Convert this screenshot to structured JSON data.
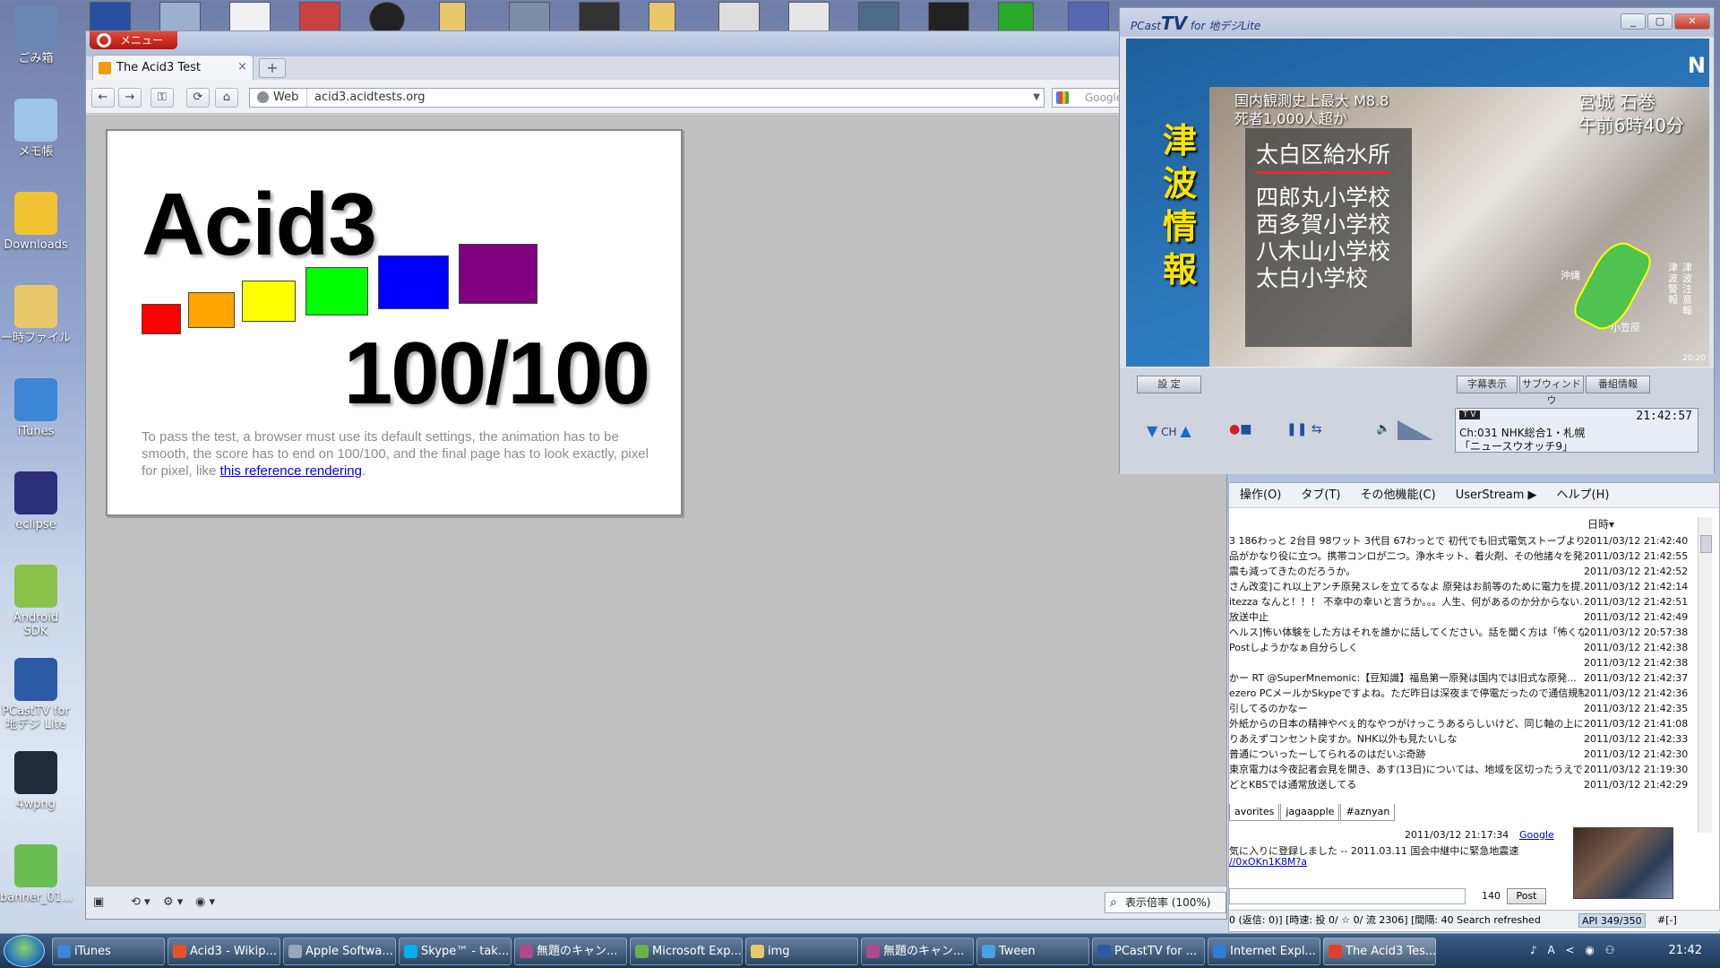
{
  "desktop": {
    "icons": [
      {
        "label": "ごみ箱",
        "color": "#6a87b4"
      },
      {
        "label": "メモ帳",
        "color": "#9ec4e6"
      },
      {
        "label": "Downloads",
        "color": "#f1c232"
      },
      {
        "label": "一時ファイル",
        "color": "#e8c86a"
      },
      {
        "label": "iTunes",
        "color": "#3e86d6"
      },
      {
        "label": "eclipse",
        "color": "#2d2f7a"
      },
      {
        "label": "Android SDK",
        "color": "#8ac249"
      },
      {
        "label": "PCastTV for 地デジ Lite",
        "color": "#2b5aa6"
      },
      {
        "label": "4wpng",
        "color": "#1f2a3a"
      },
      {
        "label": "banner_01...",
        "color": "#6bbf52"
      }
    ]
  },
  "browser": {
    "menu_label": "メニュー",
    "tab_title": "The Acid3 Test",
    "tab_close": "×",
    "newtab": "+",
    "nav": {
      "back": "←",
      "forward": "→",
      "key": "⚿",
      "reload": "⟳",
      "home": "⌂"
    },
    "address": {
      "engine": "Web",
      "url": "acid3.acidtests.org"
    },
    "search_placeholder": "Google",
    "page": {
      "title": "Acid3",
      "score": "100/100",
      "description_before": "To pass the test, a browser must use its default settings, the animation has to be smooth, the score has to end on 100/100, and the final page has to look exactly, pixel for pixel, like ",
      "link_text": "this reference rendering",
      "description_after": ".",
      "squares": [
        {
          "color": "#ff0000"
        },
        {
          "color": "#ffa500"
        },
        {
          "color": "#ffff00"
        },
        {
          "color": "#00ff00"
        },
        {
          "color": "#0000ff"
        },
        {
          "color": "#800080"
        }
      ]
    },
    "zoom": "表示倍率 (100%)"
  },
  "tween": {
    "menu": [
      "操作(O)",
      "タブ(T)",
      "その他機能(C)",
      "UserStream ▶",
      "ヘルプ(H)"
    ],
    "col_date": "日時▾",
    "rows": [
      {
        "text": "3 186わっと 2台目 98ワット 3代目 67わっとで 初代でも旧式電気ストーブより少な...",
        "date": "2011/03/12 21:42:40"
      },
      {
        "text": "品がかなり役に立つ。携帯コンロが二つ。浄水キット、着火剤、その他諸々を発掘し...",
        "date": "2011/03/12 21:42:55"
      },
      {
        "text": "震も減ってきたのだろうか。",
        "date": "2011/03/12 21:42:52"
      },
      {
        "text": "さん改変]これ以上アンチ原発スレを立てるなよ 原発はお前等のために電力を提...",
        "date": "2011/03/12 21:42:14"
      },
      {
        "text": "itezza なんと！！！ 不幸中の幸いと言うか。。。人生、何があるのか分からない...",
        "date": "2011/03/12 21:42:51"
      },
      {
        "text": "放送中止",
        "date": "2011/03/12 21:42:49"
      },
      {
        "text": "ヘルス]怖い体験をした方はそれを誰かに話してください。話を聞く方は「怖くないよ」...",
        "date": "2011/03/12 20:57:38"
      },
      {
        "text": "Postしようかなぁ自分らしく",
        "date": "2011/03/12 21:42:38"
      },
      {
        "text": "",
        "date": "2011/03/12 21:42:38"
      },
      {
        "text": "かー RT @SuperMnemonic:【豆知識】福島第一原発は国内では旧式な原発...",
        "date": "2011/03/12 21:42:37"
      },
      {
        "text": "ezero PCメールかSkypeですよね。ただ昨日は深夜まで停電だったので通信規制...",
        "date": "2011/03/12 21:42:36"
      },
      {
        "text": "引してるのかなー",
        "date": "2011/03/12 21:42:35"
      },
      {
        "text": "外紙からの日本の精神やべぇ的なやつがけっこうあるらしいけど、同じ軸の上にKAR...",
        "date": "2011/03/12 21:41:08"
      },
      {
        "text": "りあえずコンセント戻すか。NHK以外も見たいしな",
        "date": "2011/03/12 21:42:33"
      },
      {
        "text": "普通についったーしてられるのはだいぶ奇跡",
        "date": "2011/03/12 21:42:30"
      },
      {
        "text": "東京電力は今夜記者会見を開き、あす(13日)については、地域を区切ったうえで...",
        "date": "2011/03/12 21:19:30"
      },
      {
        "text": "どとKBSでは通常放送してる",
        "date": "2011/03/12 21:42:29"
      }
    ],
    "tabs": [
      "avorites",
      "jagaapple",
      "#aznyan"
    ],
    "detail": {
      "datetime": "2011/03/12 21:17:34",
      "source": "Google",
      "message": "気に入りに登録しました -- 2011.03.11 国会中継中に緊急地震速",
      "link": "//0xOKn1K8M?a"
    },
    "count": "140",
    "post": "Post",
    "status": "0 (返信: 0)] [時速: 投 0/ ☆ 0/ 流 2306] [間隔: 40",
    "status_search": "Search refreshed",
    "api": "API 349/350",
    "extra": "#[-]"
  },
  "pcast": {
    "logo_small": "PCast",
    "logo_big": "TV",
    "logo_sub": "for 地デジLite",
    "winbtns": [
      "_",
      "▢",
      "✕"
    ],
    "tsunami": "津波情報",
    "tv_n": "N",
    "headline": [
      "国内観測史上最大 M8.8",
      "死者1,000人超か"
    ],
    "location": [
      "宮城 石巻",
      "午前6時40分"
    ],
    "shelter_first": "太白区給水所",
    "shelters": [
      "四郎丸小学校",
      "西多賀小学校",
      "八木山小学校",
      "太白小学校"
    ],
    "map_okinawa": "沖縄",
    "map_ogasawara": "小笠原",
    "legend_warning": "津波警報",
    "legend_advisory": "津波注意報",
    "badge": "20:20",
    "btn_settings": "設 定",
    "btn_subtitle": "字幕表示",
    "btn_subwindow": "サブウィンドウ",
    "btn_program": "番組情報",
    "ch_label": "CH",
    "lcd_tv": "T V",
    "lcd_time": "21:42:57",
    "lcd_channel": "Ch:031  NHK総合1・札幌",
    "lcd_program": "「ニュースウオッチ9」"
  },
  "taskbar": {
    "items": [
      {
        "label": "iTunes",
        "color": "#3e86d6"
      },
      {
        "label": "Acid3 - Wikip...",
        "color": "#e2552a"
      },
      {
        "label": "Apple Softwa...",
        "color": "#9aa7b8"
      },
      {
        "label": "Skype™ - tak...",
        "color": "#00aff0"
      },
      {
        "label": "無題のキャン...",
        "color": "#b04a8e"
      },
      {
        "label": "Microsoft Exp...",
        "color": "#6bb14a"
      },
      {
        "label": "img",
        "color": "#e8c86a"
      },
      {
        "label": "無題のキャン...",
        "color": "#b04a8e"
      },
      {
        "label": "Tween",
        "color": "#4aa0e0"
      },
      {
        "label": "PCastTV for ...",
        "color": "#2b5aa6"
      },
      {
        "label": "Internet Expl...",
        "color": "#2f7fd6"
      },
      {
        "label": "The Acid3 Tes...",
        "color": "#e2402a"
      }
    ],
    "tray_icons": "♪ A < ◉ ⚇",
    "clock": "21:42"
  }
}
